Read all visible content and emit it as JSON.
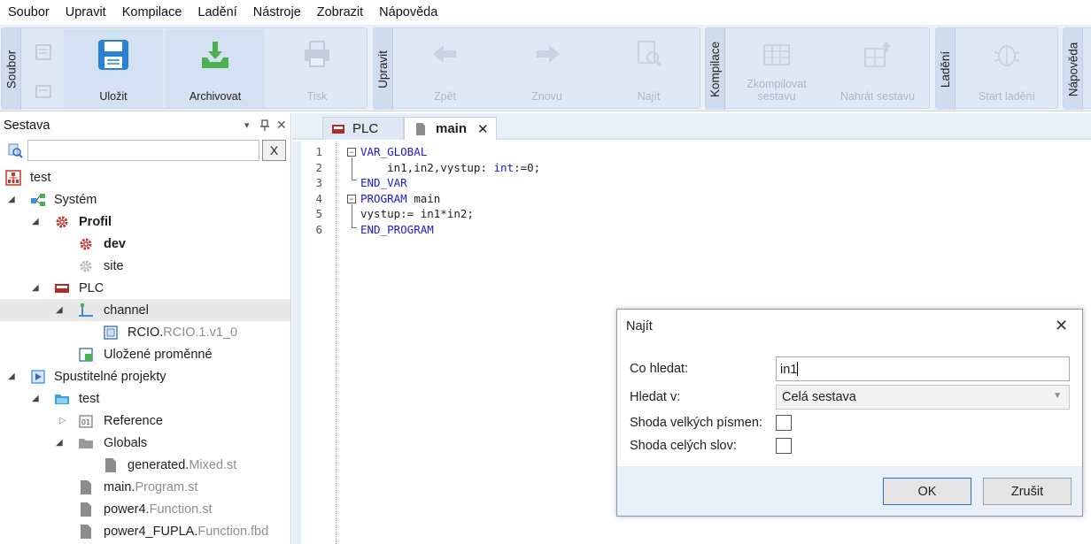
{
  "menu": [
    "Soubor",
    "Upravit",
    "Kompilace",
    "Ladění",
    "Nástroje",
    "Zobrazit",
    "Nápověda"
  ],
  "ribbon": {
    "soubor": {
      "title": "Soubor",
      "save": "Uložit",
      "archive": "Archivovat",
      "print": "Tisk"
    },
    "upravit": {
      "title": "Upravit",
      "back": "Zpět",
      "forward": "Znovu",
      "find": "Najít"
    },
    "kompilace": {
      "title": "Kompilace",
      "compile_line1": "Zkompilovat",
      "compile_line2": "sestavu",
      "upload": "Nahrát sestavu"
    },
    "ladeni": {
      "title": "Ladění",
      "start": "Start ladění"
    },
    "napoveda": {
      "title": "Nápověda"
    }
  },
  "panel": {
    "title": "Sestava",
    "pin": "▾",
    "pin2": "⊣",
    "close": "✕",
    "search_value": "",
    "clear": "X"
  },
  "tree": [
    {
      "label": "test",
      "suffix": "",
      "bold": false
    },
    {
      "label": "Systém",
      "suffix": "",
      "bold": false
    },
    {
      "label": "Profil",
      "suffix": "",
      "bold": true
    },
    {
      "label": "dev",
      "suffix": "",
      "bold": true
    },
    {
      "label": "site",
      "suffix": "",
      "bold": false
    },
    {
      "label": "PLC",
      "suffix": "",
      "bold": false
    },
    {
      "label": "channel",
      "suffix": "",
      "bold": false
    },
    {
      "label": "RCIO.",
      "suffix": "RCIO.1.v1_0",
      "bold": false
    },
    {
      "label": "Uložené proměnné",
      "suffix": "",
      "bold": false
    },
    {
      "label": "Spustitelné projekty",
      "suffix": "",
      "bold": false
    },
    {
      "label": "test",
      "suffix": "",
      "bold": false
    },
    {
      "label": "Reference",
      "suffix": "",
      "bold": false
    },
    {
      "label": "Globals",
      "suffix": "",
      "bold": false
    },
    {
      "label": "generated.",
      "suffix": "Mixed.st",
      "bold": false
    },
    {
      "label": "main.",
      "suffix": "Program.st",
      "bold": false
    },
    {
      "label": "power4.",
      "suffix": "Function.st",
      "bold": false
    },
    {
      "label": "power4_FUPLA.",
      "suffix": "Function.fbd",
      "bold": false
    }
  ],
  "tabs": [
    {
      "label": "PLC"
    },
    {
      "label": "main",
      "close": "✕"
    }
  ],
  "code": {
    "line_numbers": [
      "1",
      "2",
      "3",
      "4",
      "5",
      "6"
    ],
    "lines": [
      {
        "kw1": "VAR_GLOBAL",
        "rest": "",
        "kw2": "",
        "tail": ""
      },
      {
        "kw1": "",
        "rest": "    in1,in2,vystup: ",
        "kw2": "int",
        "tail": ":=0;"
      },
      {
        "kw1": "END_VAR",
        "rest": "",
        "kw2": "",
        "tail": ""
      },
      {
        "kw1": "PROGRAM",
        "rest": " main",
        "kw2": "",
        "tail": ""
      },
      {
        "kw1": "",
        "rest": "vystup:= in1*in2;",
        "kw2": "",
        "tail": ""
      },
      {
        "kw1": "END_PROGRAM",
        "rest": "",
        "kw2": "",
        "tail": ""
      }
    ]
  },
  "dialog": {
    "title": "Najít",
    "close": "✕",
    "find_label": "Co hledat:",
    "find_value": "in1",
    "scope_label": "Hledat v:",
    "scope_value": "Celá sestava",
    "case_label": "Shoda velkých písmen:",
    "words_label": "Shoda celých slov:",
    "ok": "OK",
    "cancel": "Zrušit"
  }
}
